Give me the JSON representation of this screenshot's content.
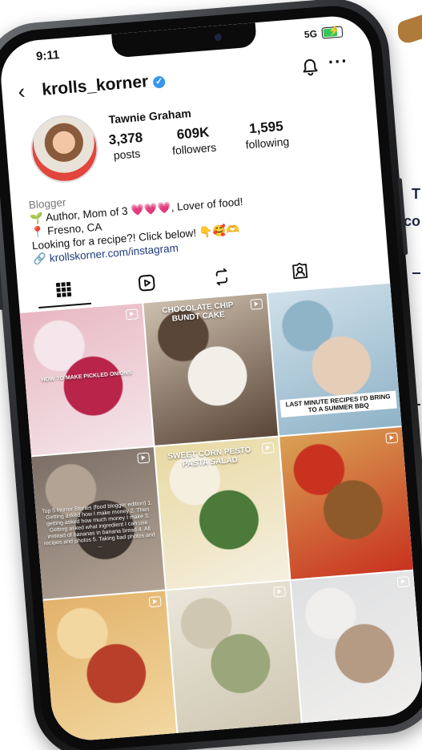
{
  "status": {
    "time": "9:11",
    "network": "5G"
  },
  "header": {
    "username": "krolls_korner"
  },
  "profile": {
    "name": "Tawnie Graham",
    "stats": [
      {
        "value": "3,378",
        "label": "posts"
      },
      {
        "value": "609K",
        "label": "followers"
      },
      {
        "value": "1,595",
        "label": "following"
      }
    ],
    "bio": {
      "category": "Blogger",
      "line1": "Author, Mom of 3 💗💗💗, Lover of food!",
      "line2": "Fresno, CA",
      "line3": "Looking for a recipe?! Click below! 👇🥰🫶",
      "link": "krollskorner.com/instagram"
    }
  },
  "posts": [
    {
      "caption": "HOW TO MAKE PICKLED ONIONS",
      "colors": [
        "#e8b7c2",
        "#b8244a",
        "#f4e6ea"
      ]
    },
    {
      "caption": "CHOCOLATE CHIP BUNDT CAKE",
      "colors": [
        "#cdbfae",
        "#f2efe9",
        "#5a4638"
      ]
    },
    {
      "caption": "LAST MINUTE RECIPES I'D BRING TO A SUMMER BBQ",
      "colors": [
        "#cfe0ea",
        "#e6cdb8",
        "#8fb3c7"
      ]
    },
    {
      "caption": "Top 5 Horror Stories (food blogger edition) 1. Getting asked how I make money 2. Then getting asked how much money I make 3. Getting asked what ingredient I can use instead of bananas in banana bread 4. All recipes and photos 5. Taking bad photos and ...",
      "colors": [
        "#7b6f66",
        "#3d342f",
        "#b3a395"
      ]
    },
    {
      "caption": "SWEET CORN PESTO PASTA SALAD",
      "colors": [
        "#e8d9a2",
        "#4b7a3a",
        "#f5efe0"
      ]
    },
    {
      "caption": "",
      "colors": [
        "#d9a154",
        "#8e5a2a",
        "#c8321f"
      ]
    },
    {
      "caption": "",
      "colors": [
        "#e2b26a",
        "#b8402a",
        "#f2d7a0"
      ]
    },
    {
      "caption": "",
      "colors": [
        "#eae6da",
        "#9aa77a",
        "#cfc7b2"
      ]
    },
    {
      "caption": "",
      "colors": [
        "#dfe0e2",
        "#b59a84",
        "#f0efed"
      ]
    }
  ],
  "side": {
    "line1": "T",
    "line2": "co"
  }
}
